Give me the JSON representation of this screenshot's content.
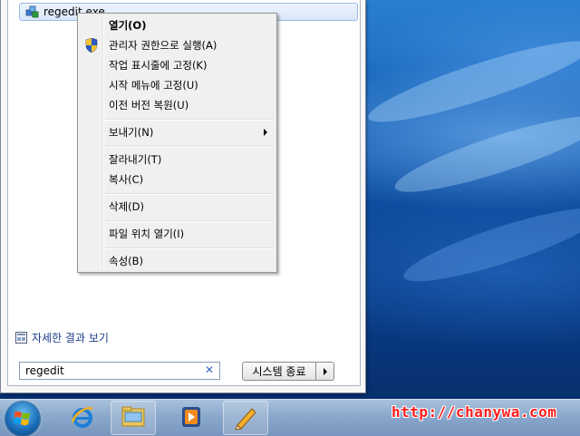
{
  "search_results": {
    "program": "regedit.exe"
  },
  "context_menu": {
    "items": [
      {
        "label": "열기(O)",
        "bold": true
      },
      {
        "label": "관리자 권한으로 실행(A)",
        "icon": "uac-shield-icon"
      },
      {
        "label": "작업 표시줄에 고정(K)"
      },
      {
        "label": "시작 메뉴에 고정(U)"
      },
      {
        "label": "이전 버전 복원(U)"
      },
      {
        "label": "보내기(N)",
        "submenu": true
      },
      {
        "label": "잘라내기(T)"
      },
      {
        "label": "복사(C)"
      },
      {
        "label": "삭제(D)"
      },
      {
        "label": "파일 위치 열기(I)"
      },
      {
        "label": "속성(B)"
      }
    ]
  },
  "see_more": {
    "label": "자세한 결과 보기",
    "icon": "see-more-results-icon"
  },
  "search": {
    "value": "regedit",
    "clear_icon": "clear-search-icon"
  },
  "shutdown": {
    "label": "시스템 종료",
    "arrow_icon": "chevron-right-icon"
  },
  "taskbar": {
    "items": [
      {
        "name": "start-orb",
        "icon": "windows-logo-icon"
      },
      {
        "name": "internet-explorer",
        "icon": "ie-icon"
      },
      {
        "name": "windows-explorer",
        "icon": "folder-icon"
      },
      {
        "name": "media-player",
        "icon": "media-player-icon"
      },
      {
        "name": "paint",
        "icon": "pencil-icon"
      }
    ]
  },
  "watermark": "http://chanywa.com",
  "colors": {
    "context_menu_bg": "#f0f0f0",
    "link_text": "#1a3a8a",
    "watermark": "#ff1e1e"
  }
}
